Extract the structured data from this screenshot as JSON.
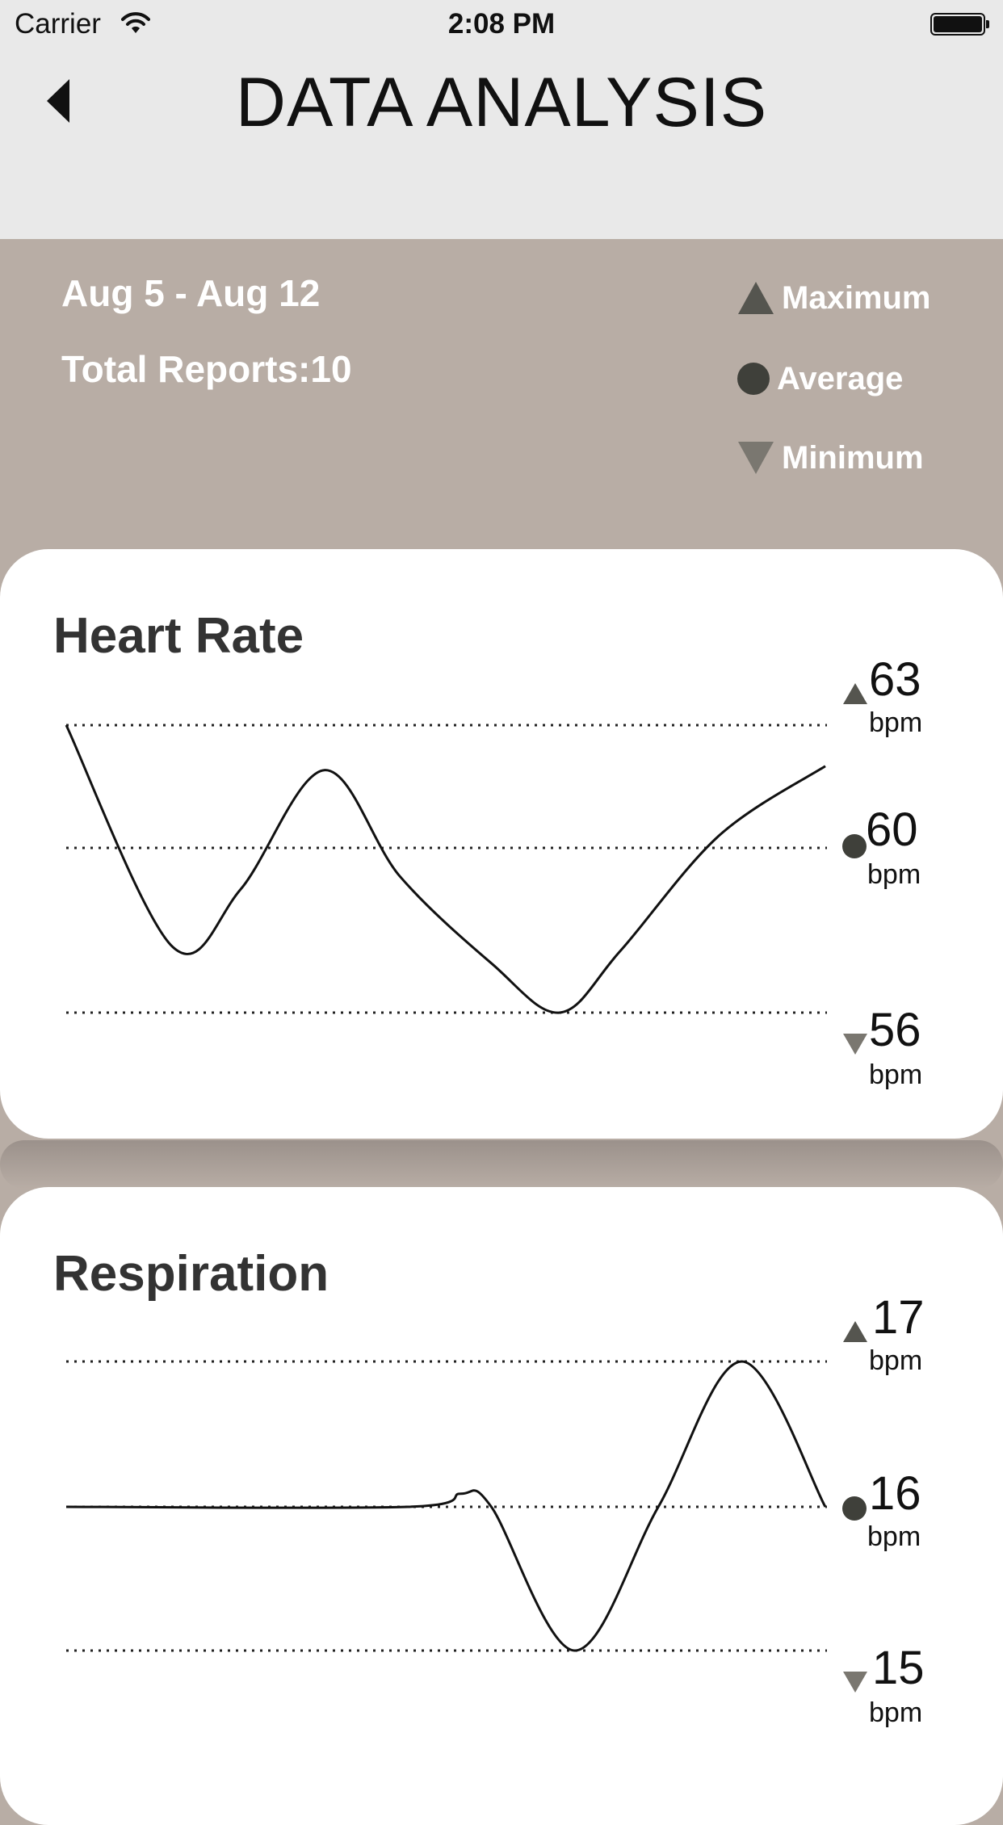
{
  "status_bar": {
    "carrier": "Carrier",
    "time": "2:08 PM",
    "battery_level": 1.0
  },
  "header": {
    "title": "DATA ANALYSIS",
    "back_icon": "chevron-left-icon"
  },
  "summary": {
    "date_range": "Aug 5 - Aug 12",
    "total_reports": "Total Reports:10",
    "legend": [
      {
        "label": "Maximum",
        "icon": "triangle-up-icon",
        "color": "#55554f"
      },
      {
        "label": "Average",
        "icon": "circle-icon",
        "color": "#3f403a"
      },
      {
        "label": "Minimum",
        "icon": "triangle-down-icon",
        "color": "#7a7770"
      }
    ]
  },
  "colors": {
    "background": "#b8ada5",
    "header": "#e9e9e9",
    "card": "#ffffff",
    "line": "#111111"
  },
  "chart_data": [
    {
      "type": "line",
      "title": "Heart Rate",
      "ylim": [
        56,
        63
      ],
      "reference_lines": {
        "max": {
          "value": 63,
          "label": "63",
          "unit": "bpm"
        },
        "avg": {
          "value": 60,
          "label": "60",
          "unit": "bpm"
        },
        "min": {
          "value": 56,
          "label": "56",
          "unit": "bpm"
        }
      },
      "x": [
        0,
        0.14,
        0.23,
        0.34,
        0.44,
        0.56,
        0.65,
        0.73,
        0.86,
        1.0
      ],
      "values": [
        63,
        57.6,
        59,
        61.9,
        59.3,
        57.2,
        56,
        57.5,
        60.3,
        62
      ]
    },
    {
      "type": "line",
      "title": "Respiration",
      "ylim": [
        15,
        17
      ],
      "reference_lines": {
        "max": {
          "value": 17,
          "label": "17",
          "unit": "bpm"
        },
        "avg": {
          "value": 16,
          "label": "16",
          "unit": "bpm"
        },
        "min": {
          "value": 15,
          "label": "15",
          "unit": "bpm"
        }
      },
      "x": [
        0,
        0.45,
        0.52,
        0.56,
        0.67,
        0.78,
        0.89,
        1.0
      ],
      "values": [
        16,
        16,
        16.09,
        16,
        15,
        16,
        17,
        16
      ]
    }
  ]
}
